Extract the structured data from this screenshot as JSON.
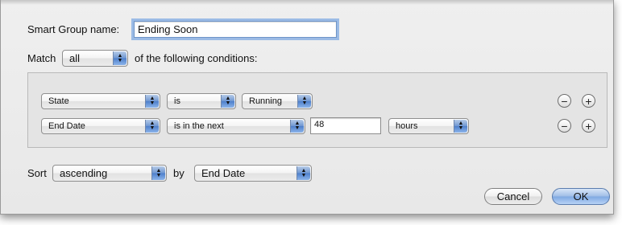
{
  "dialog": {
    "name_label": "Smart Group name:",
    "name_value": "Ending Soon",
    "match_label": "Match",
    "match_value": "all",
    "match_suffix": "of the following conditions:"
  },
  "conditions": [
    {
      "field": "State",
      "operator": "is",
      "value": "Running",
      "remove": "−",
      "add": "+"
    },
    {
      "field": "End Date",
      "operator": "is in the next",
      "value": "48",
      "unit": "hours",
      "remove": "−",
      "add": "+"
    }
  ],
  "sort": {
    "label": "Sort",
    "order": "ascending",
    "by_label": "by",
    "by_value": "End Date"
  },
  "buttons": {
    "cancel": "Cancel",
    "ok": "OK"
  },
  "icons": {
    "popup_arrows": "updown-arrows-icon"
  }
}
